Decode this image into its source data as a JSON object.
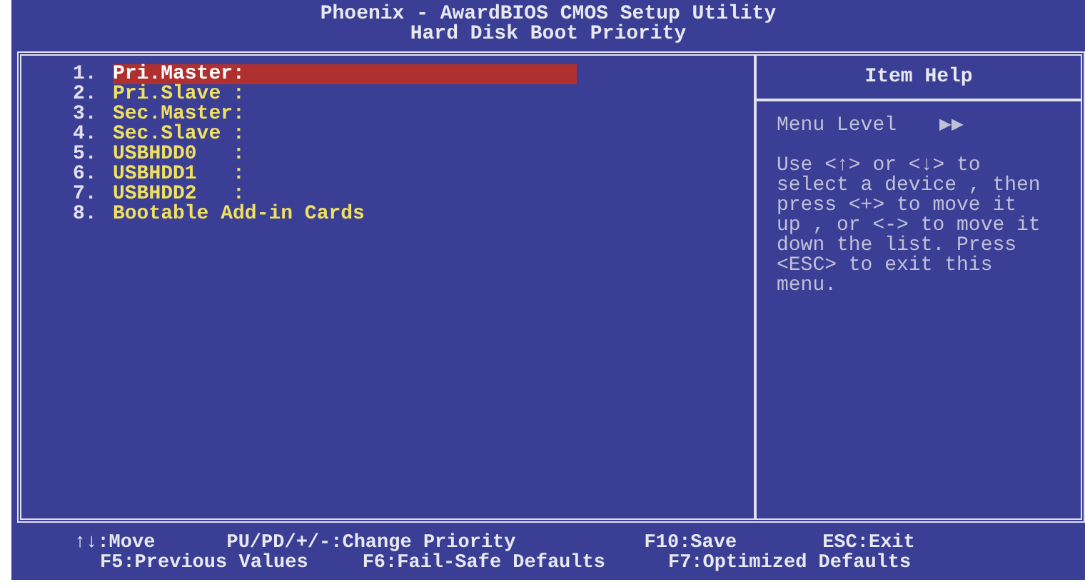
{
  "header": {
    "title": "Phoenix - AwardBIOS CMOS Setup Utility",
    "subtitle": "Hard Disk Boot Priority"
  },
  "items": [
    {
      "number": "1.",
      "label": "Pri.Master:",
      "selected": true
    },
    {
      "number": "2.",
      "label": "Pri.Slave :",
      "selected": false
    },
    {
      "number": "3.",
      "label": "Sec.Master:",
      "selected": false
    },
    {
      "number": "4.",
      "label": "Sec.Slave :",
      "selected": false
    },
    {
      "number": "5.",
      "label": "USBHDD0   :",
      "selected": false
    },
    {
      "number": "6.",
      "label": "USBHDD1   :",
      "selected": false
    },
    {
      "number": "7.",
      "label": "USBHDD2   :",
      "selected": false
    },
    {
      "number": "8.",
      "label": "Bootable Add-in Cards",
      "selected": false
    }
  ],
  "help": {
    "title": "Item Help",
    "menu_level_label": "Menu Level",
    "menu_level_value": "▶▶",
    "lines": [
      "Use <↑> or <↓> to",
      "select a device , then",
      "press <+> to move it",
      "up , or <-> to move it",
      "down the list. Press",
      "<ESC> to exit this",
      "menu."
    ]
  },
  "footer": [
    [
      "↑↓:Move",
      "PU/PD/+/-:Change Priority",
      "F10:Save",
      "ESC:Exit"
    ],
    [
      "F5:Previous Values",
      "F6:Fail-Safe Defaults",
      "F7:Optimized Defaults"
    ]
  ]
}
